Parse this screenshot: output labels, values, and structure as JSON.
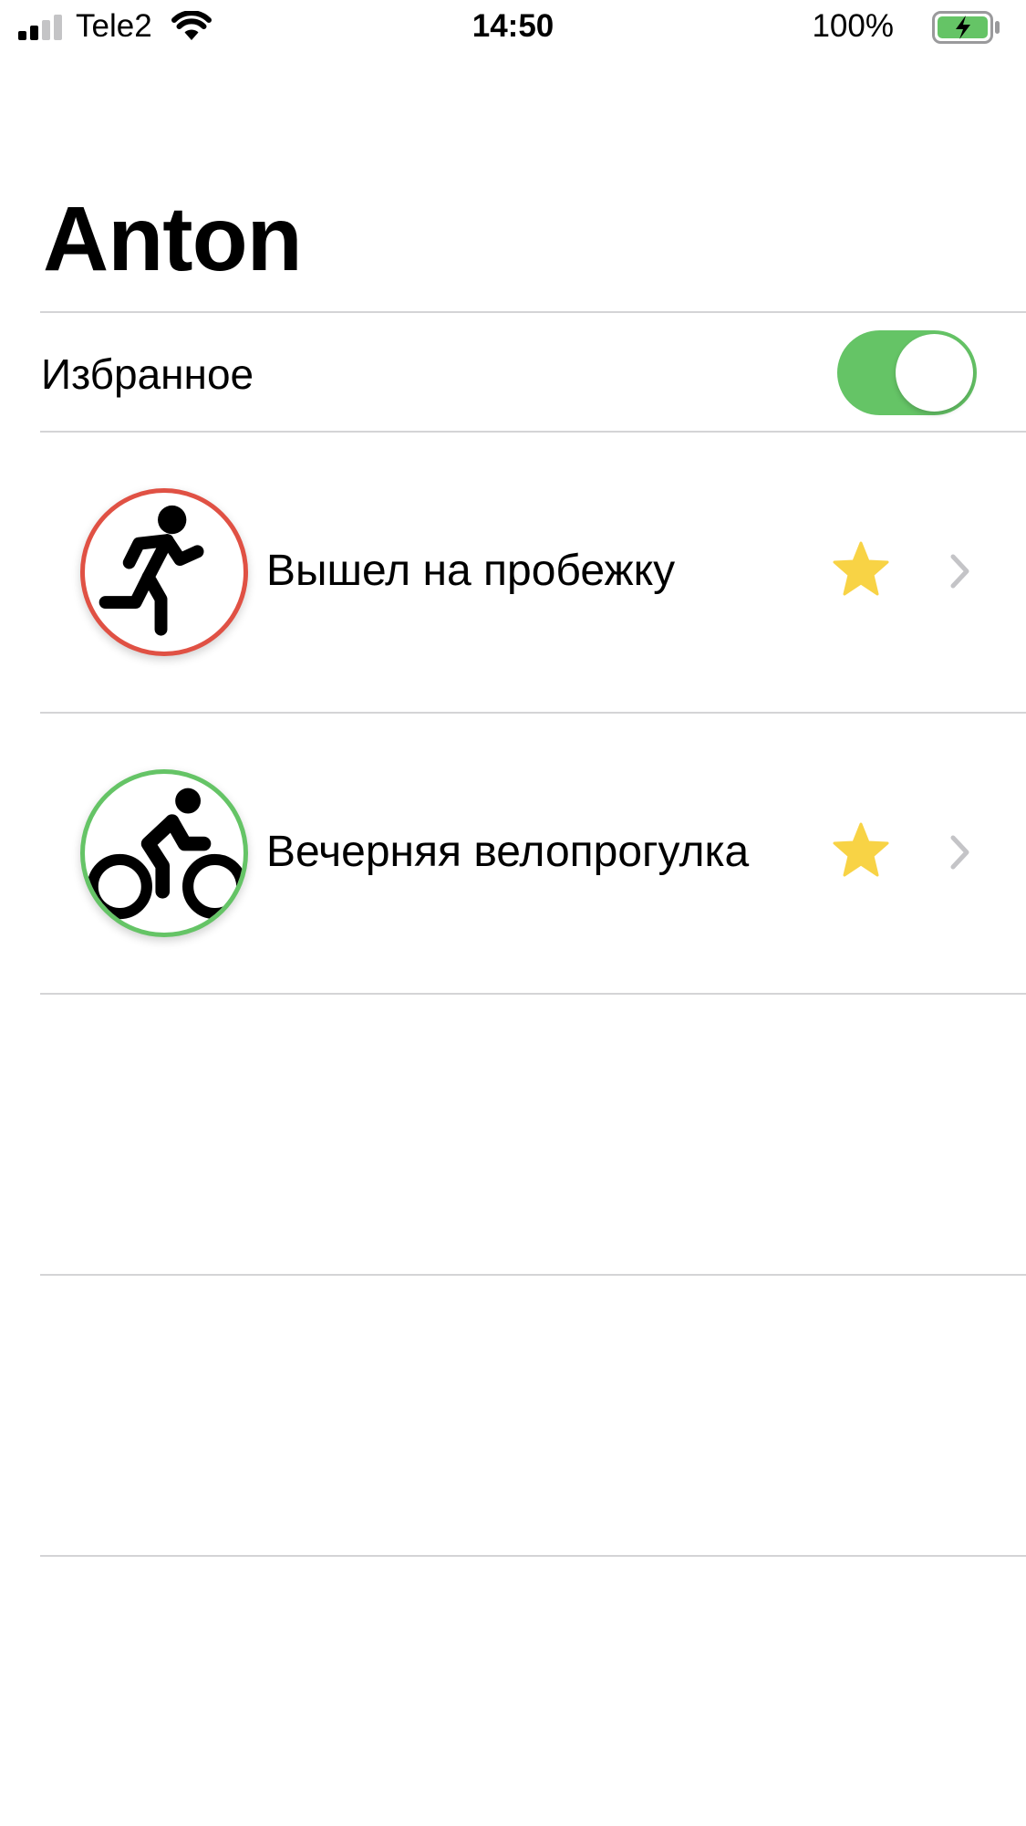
{
  "status_bar": {
    "carrier": "Tele2",
    "time": "14:50",
    "battery_percent": "100%",
    "signal_icon": "cellular-signal-icon",
    "wifi_icon": "wifi-icon",
    "battery_icon": "battery-charging-icon",
    "signal_bars_filled": 2,
    "signal_bars_total": 4,
    "battery_level": 1.0,
    "battery_color": "#65c466"
  },
  "header": {
    "title": "Anton"
  },
  "favorites": {
    "label": "Избранное",
    "toggle_on": true,
    "toggle_color": "#65c466"
  },
  "activities": [
    {
      "title": "Вышел на пробежку",
      "icon": "running-icon",
      "ring_color": "#e05144",
      "favorite": true,
      "star_color": "#f8d345",
      "chevron_icon": "chevron-right-icon"
    },
    {
      "title": "Вечерняя велопрогулка",
      "icon": "cycling-icon",
      "ring_color": "#65c466",
      "favorite": true,
      "star_color": "#f8d345",
      "chevron_icon": "chevron-right-icon"
    }
  ]
}
